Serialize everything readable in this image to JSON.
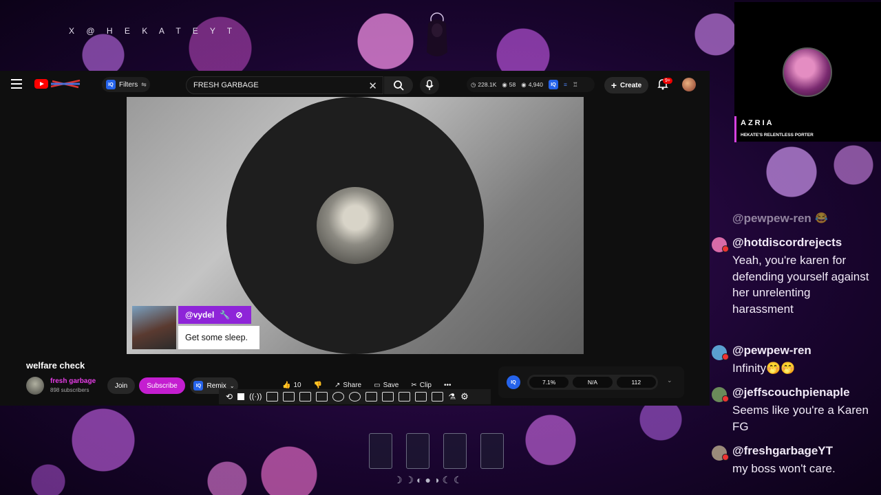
{
  "overlay": {
    "handle": "X @ H E K A T E Y T",
    "moon_phases": "☽☽◐●◑☾☾"
  },
  "youtube": {
    "filters_label": "Filters",
    "search_value": "FRESH GARBAGE",
    "stats": {
      "views": "228.1K",
      "watching": "58",
      "eye_count": "4,940"
    },
    "create_label": "Create",
    "notifications_badge": "9+",
    "video": {
      "chat_popup": {
        "username": "@vydel",
        "message": "Get some sleep."
      }
    },
    "video_title": "welfare check",
    "channel": {
      "name": "fresh garbage",
      "subscribers": "898 subscribers",
      "join_label": "Join",
      "subscribe_label": "Subscribe",
      "remix_label": "Remix"
    },
    "actions": {
      "likes": "10",
      "share": "Share",
      "save": "Save",
      "clip": "Clip"
    },
    "iq_panel": {
      "badge": "IQ",
      "values": [
        "7.1%",
        "N/A",
        "112"
      ]
    }
  },
  "streamer_cam": {
    "name": "AZRIA",
    "subtitle": "HEKATE'S RELENTLESS PORTER"
  },
  "chat": {
    "messages": [
      {
        "user": "@pewpew-ren",
        "text": "",
        "partial": true,
        "color": "#5aa0d0"
      },
      {
        "user": "@hotdiscordrejects",
        "text": "Yeah, you're karen for defending yourself against her unrelenting harassment",
        "color": "#d86aa8"
      },
      {
        "user": "@pewpew-ren",
        "text": "Infinity🤭🤭",
        "color": "#5aa0d0"
      },
      {
        "user": "@jeffscouchpienaple",
        "text": "Seems like you're a Karen FG",
        "color": "#6a8a5a"
      },
      {
        "user": "@freshgarbageYT",
        "text": "my boss won't care.",
        "color": "#9a8a7a"
      }
    ]
  },
  "colors": {
    "accent_purple": "#8e24d8",
    "subscribe": "#c41ed0",
    "yt_bg": "#0f0f0f"
  }
}
